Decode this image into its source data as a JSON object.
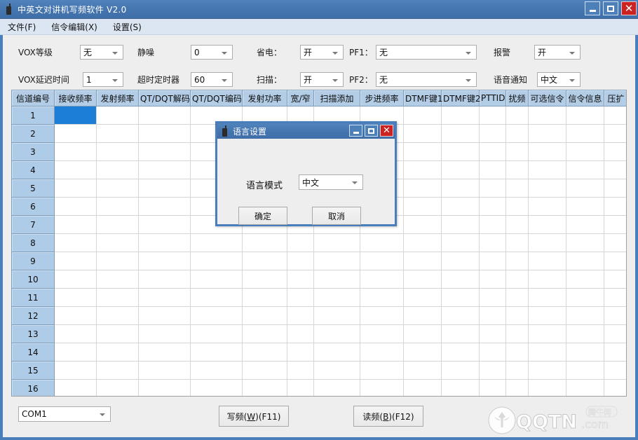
{
  "window": {
    "title": "中英文对讲机写频软件 V2.0",
    "icon": "radio-icon",
    "buttons": {
      "minimize": "_",
      "maximize": "□",
      "close": "✕"
    },
    "accent_color": "#4a7ebb",
    "background_color": "#eeeeee"
  },
  "menubar": {
    "items": [
      {
        "label": "文件(F)",
        "mnemonic": "F"
      },
      {
        "label": "信令编辑(X)",
        "mnemonic": "X"
      },
      {
        "label": "设置(S)",
        "mnemonic": "S"
      }
    ]
  },
  "settings": {
    "fields": [
      {
        "name": "vox-level",
        "label": "VOX等级",
        "value": "无"
      },
      {
        "name": "squelch",
        "label": "静噪",
        "value": "0"
      },
      {
        "name": "power-save",
        "label": "省电：",
        "value": "开"
      },
      {
        "name": "pf1",
        "label": "PF1：",
        "value": "无"
      },
      {
        "name": "alarm",
        "label": "报警",
        "value": "开"
      },
      {
        "name": "vox-delay",
        "label": "VOX延迟时间",
        "value": "1"
      },
      {
        "name": "timeout-timer",
        "label": "超时定时器",
        "value": "60"
      },
      {
        "name": "scan",
        "label": "扫描：",
        "value": "开"
      },
      {
        "name": "pf2",
        "label": "PF2：",
        "value": "无"
      },
      {
        "name": "voice-prompt",
        "label": "语音通知",
        "value": "中文"
      }
    ]
  },
  "table": {
    "columns": [
      "信道编号",
      "接收频率",
      "发射频率",
      "QT/DQT解码",
      "QT/DQT编码",
      "发射功率",
      "宽/窄",
      "扫描添加",
      "步进频率",
      "DTMF键1",
      "DTMF键2",
      "PTTID",
      "扰频",
      "可选信令",
      "信令信息",
      "压扩"
    ],
    "rows": [
      "1",
      "2",
      "3",
      "4",
      "5",
      "6",
      "7",
      "8",
      "9",
      "10",
      "11",
      "12",
      "13",
      "14",
      "15",
      "16"
    ],
    "selected_cell": {
      "row": 1,
      "column": "接收频率",
      "value": ""
    },
    "header_color": "#b4cde6",
    "rowheader_color": "#aecbe8",
    "selection_color": "#1c7ed6"
  },
  "bottombar": {
    "port": {
      "label": "COM1"
    },
    "write_button": {
      "prefix": "写频(",
      "mnemonic": "W",
      "suffix": ")(F11)"
    },
    "read_button": {
      "prefix": "读频(",
      "mnemonic": "B",
      "suffix": ")(F12)"
    }
  },
  "watermark": {
    "main": "QQTN",
    "suffix": ".com",
    "badge": "腾牛网"
  },
  "dialog": {
    "title": "语言设置",
    "icon": "radio-icon",
    "buttons": {
      "minimize": "_",
      "maximize": "□",
      "close": "✕"
    },
    "language_label": "语言模式",
    "language_value": "中文",
    "ok_label": "确定",
    "cancel_label": "取消"
  }
}
